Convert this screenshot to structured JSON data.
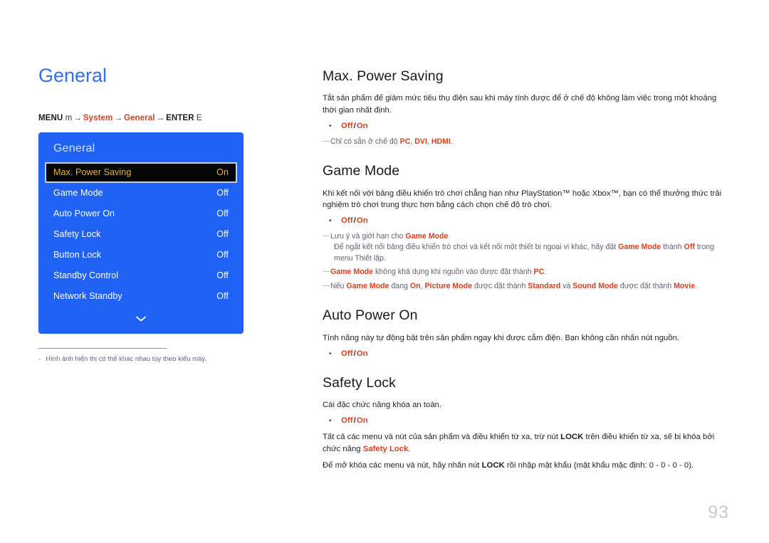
{
  "page_title": "General",
  "breadcrumb": {
    "menu_label": "MENU",
    "menu_key": "m",
    "arrow": "→",
    "item1": "System",
    "item2": "General",
    "enter_label": "ENTER",
    "enter_key": "E"
  },
  "osd": {
    "title": "General",
    "chevron": "chevron-down-icon",
    "rows": [
      {
        "label": "Max. Power Saving",
        "value": "On",
        "selected": true
      },
      {
        "label": "Game Mode",
        "value": "Off",
        "selected": false
      },
      {
        "label": "Auto Power On",
        "value": "Off",
        "selected": false
      },
      {
        "label": "Safety Lock",
        "value": "Off",
        "selected": false
      },
      {
        "label": "Button Lock",
        "value": "Off",
        "selected": false
      },
      {
        "label": "Standby Control",
        "value": "Off",
        "selected": false
      },
      {
        "label": "Network Standby",
        "value": "Off",
        "selected": false
      }
    ]
  },
  "left_footnote": {
    "dash": "-",
    "text": "Hình ảnh hiển thị có thể khác nhau tùy theo kiểu máy."
  },
  "sections": {
    "max_power_saving": {
      "title": "Max. Power Saving",
      "body": "Tắt sản phẩm để giảm mức tiêu thụ điện sau khi máy tính được để ở chế độ không làm việc trong một khoảng thời gian nhất định.",
      "option_off": "Off",
      "option_slash": "/",
      "option_on": "On",
      "note_prefix": "Chỉ có sẵn ở chế độ ",
      "note_pc": "PC",
      "note_sep1": ", ",
      "note_dvi": "DVI",
      "note_sep2": ", ",
      "note_hdmi": "HDMI",
      "note_suffix": "."
    },
    "game_mode": {
      "title": "Game Mode",
      "body": "Khi kết nối với bảng điều khiển trò chơi chẳng hạn như PlayStation™ hoặc Xbox™, bạn có thể thưởng thức trải nghiệm trò chơi trung thực hơn bằng cách chọn chế độ trò chơi.",
      "option_off": "Off",
      "option_slash": "/",
      "option_on": "On",
      "note1_prefix": "Lưu ý và giới hạn cho ",
      "note1_term": "Game Mode",
      "note1_sub_a": "Để ngắt kết nối bảng điều khiển trò chơi và kết nối một thiết bị ngoại vi khác, hãy đặt ",
      "note1_sub_term1": "Game Mode",
      "note1_sub_b": " thành ",
      "note1_sub_term2": "Off",
      "note1_sub_c": " trong menu Thiết lập.",
      "note2_term": "Game Mode",
      "note2_mid": " không khả dụng khi nguồn vào được đặt thành ",
      "note2_term2": "PC",
      "note2_end": ".",
      "note3_a": "Nếu ",
      "note3_term1": "Game Mode",
      "note3_b": " đang ",
      "note3_term2": "On",
      "note3_c": ", ",
      "note3_term3": "Picture Mode",
      "note3_d": " được đặt thành ",
      "note3_term4": "Standard",
      "note3_e": " và ",
      "note3_term5": "Sound Mode",
      "note3_f": " được đặt thành ",
      "note3_term6": "Movie",
      "note3_end": "."
    },
    "auto_power_on": {
      "title": "Auto Power On",
      "body": "Tính năng này tự động bật trên sản phẩm ngay khi được cắm điện. Bạn không cần nhấn nút nguồn.",
      "option_off": "Off",
      "option_slash": "/",
      "option_on": "On"
    },
    "safety_lock": {
      "title": "Safety Lock",
      "body": "Cài đặc chức năng khóa an toàn.",
      "option_off": "Off",
      "option_slash": "/",
      "option_on": "On",
      "para2_a": "Tất cả các menu và nút của sản phẩm và điều khiển từ xa, trừ nút ",
      "para2_lock": "LOCK",
      "para2_b": " trên điều khiển từ xa, sẽ bị khóa bởi chức năng ",
      "para2_term": "Safety Lock",
      "para2_end": ".",
      "para3_a": "Để mở khóa các menu và nút, hãy nhấn nút ",
      "para3_lock": "LOCK",
      "para3_b": " rồi nhập mật khẩu (mật khẩu mặc định: 0 - 0 - 0 - 0)."
    }
  },
  "page_number": "93",
  "colors": {
    "accent_blue": "#2062f5",
    "title_blue": "#2f6ef0",
    "accent_red": "#e23b17",
    "osd_selected_bg": "#050505",
    "osd_selected_text": "#f0b41e",
    "note_gray": "#5f6472",
    "page_number_gray": "#c9cbd2"
  }
}
